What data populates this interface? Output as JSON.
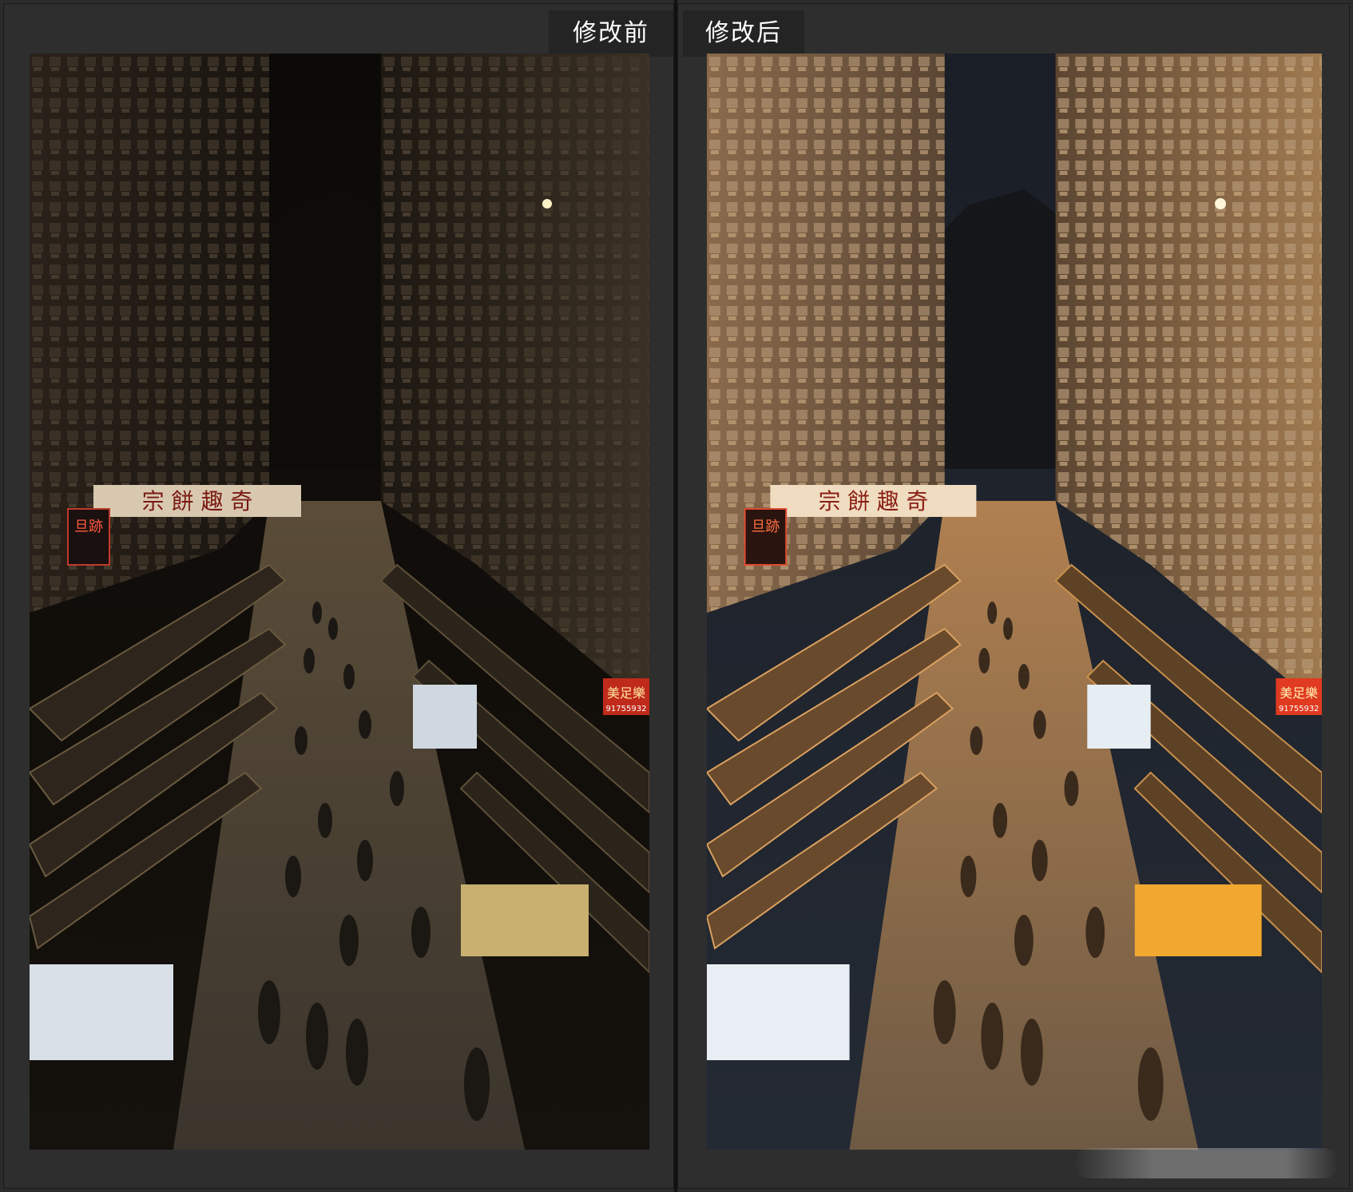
{
  "panels": {
    "before": {
      "label": "修改前"
    },
    "after": {
      "label": "修改后"
    }
  },
  "photo": {
    "sign_top": "宗 餅 趣 奇",
    "sign_left": "旦跡",
    "sign_right": "美足樂",
    "sign_right_phone": "91755932"
  }
}
